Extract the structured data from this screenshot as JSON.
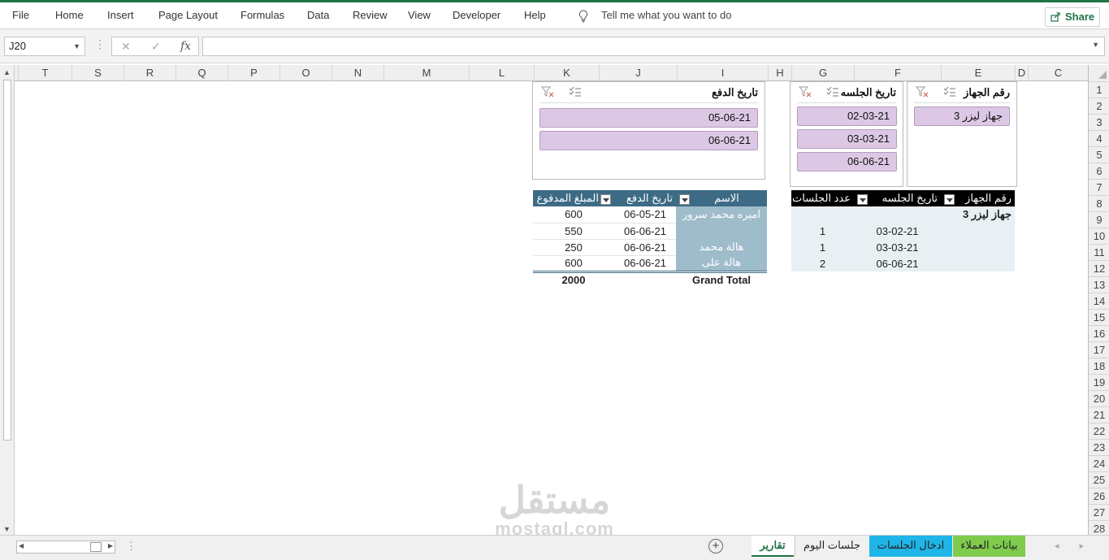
{
  "ribbon": {
    "tabs": [
      "File",
      "Home",
      "Insert",
      "Page Layout",
      "Formulas",
      "Data",
      "Review",
      "View",
      "Developer",
      "Help"
    ],
    "tell_me": "Tell me what you want to do",
    "share": "Share"
  },
  "formula_bar": {
    "name_box": "J20",
    "fx": "fx",
    "cancel": "✕",
    "enter": "✓",
    "value": ""
  },
  "columns": [
    "T",
    "S",
    "R",
    "Q",
    "P",
    "O",
    "N",
    "M",
    "L",
    "K",
    "J",
    "I",
    "H",
    "G",
    "F",
    "E",
    "D",
    "C"
  ],
  "rows": [
    "1",
    "2",
    "3",
    "4",
    "5",
    "6",
    "7",
    "8",
    "9",
    "10",
    "11",
    "12",
    "13",
    "14",
    "15",
    "16",
    "17",
    "18",
    "19",
    "20",
    "21",
    "22",
    "23",
    "24",
    "25",
    "26",
    "27",
    "28"
  ],
  "slicers": {
    "device": {
      "title": "رقم الجهاز",
      "items": [
        "جهاز ليزر 3"
      ]
    },
    "session_date": {
      "title": "تاريخ الجلسه",
      "items": [
        "02-03-21",
        "03-03-21",
        "06-06-21"
      ]
    },
    "payment_date": {
      "title": "تاريخ الدفع",
      "items": [
        "05-06-21",
        "06-06-21"
      ]
    }
  },
  "sessions_pivot": {
    "headers": {
      "device": "رقم الجهاز",
      "date": "تاريخ الجلسه",
      "count": "عدد الجلسات"
    },
    "group_label": "جهاز ليزر 3",
    "rows": [
      {
        "date": "03-02-21",
        "count": "1"
      },
      {
        "date": "03-03-21",
        "count": "1"
      },
      {
        "date": "06-06-21",
        "count": "2"
      }
    ]
  },
  "payments_pivot": {
    "headers": {
      "name": "الاسم",
      "date": "تاريخ الدفع",
      "amount": "المبلغ المدفوع"
    },
    "rows": [
      {
        "name": "اميره محمد سرور",
        "date": "06-05-21",
        "amount": "600"
      },
      {
        "name": "",
        "date": "06-06-21",
        "amount": "550"
      },
      {
        "name": "هالة محمد",
        "date": "06-06-21",
        "amount": "250"
      },
      {
        "name": "هالة على",
        "date": "06-06-21",
        "amount": "600"
      }
    ],
    "grand_total_label": "Grand Total",
    "grand_total_value": "2000"
  },
  "watermark": {
    "arabic": "مستقل",
    "latin": "mostaql.com"
  },
  "sheet_tabs": [
    {
      "label": "تقارير",
      "color": "#ffffff",
      "active": true
    },
    {
      "label": "جلسات اليوم",
      "color": "#f0f0f0",
      "active": false
    },
    {
      "label": "ادخال الجلسات",
      "color": "#1fb5e8",
      "active": false
    },
    {
      "label": "بيانات العملاء",
      "color": "#7fcb4b",
      "active": false
    }
  ]
}
